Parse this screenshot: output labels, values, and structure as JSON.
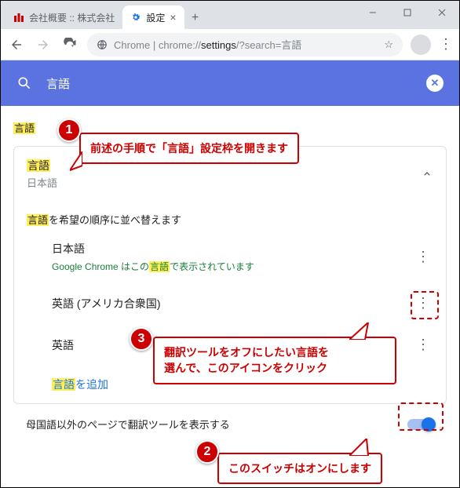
{
  "window": {
    "tabs": [
      {
        "favicon": "atmark",
        "title": "会社概要 :: 株式会社"
      },
      {
        "favicon": "gear",
        "title": "設定"
      }
    ],
    "controls": {
      "minimize": "–",
      "maximize": "□",
      "close": "×"
    }
  },
  "toolbar": {
    "url_prefix": "Chrome",
    "url_sep": " | ",
    "url_main": "chrome://",
    "url_bold": "settings",
    "url_query": "/?search=言語"
  },
  "searchbar": {
    "query": "言語",
    "clear": "✕"
  },
  "section": {
    "title_hl": "言語"
  },
  "card": {
    "head_title_hl": "言語",
    "head_sub": "日本語",
    "instruction_pre_hl": "言語",
    "instruction_rest": "を希望の順序に並べ替えます",
    "langs": [
      {
        "name": "日本語",
        "desc_pre": "Google Chrome はこの",
        "desc_hl": "言語",
        "desc_post": "で表示されています"
      },
      {
        "name": "英語 (アメリカ合衆国)",
        "desc_pre": "",
        "desc_hl": "",
        "desc_post": ""
      },
      {
        "name": "英語",
        "desc_pre": "",
        "desc_hl": "",
        "desc_post": ""
      }
    ],
    "add_pre_hl": "言語",
    "add_rest": "を追加"
  },
  "toggle": {
    "label": "母国語以外のページで翻訳ツールを表示する",
    "on": true
  },
  "annotations": {
    "c1": {
      "num": "1",
      "text": "前述の手順で「言語」設定枠を開きます"
    },
    "c2": {
      "num": "2",
      "text": "このスイッチはオンにします"
    },
    "c3": {
      "num": "3",
      "line1": "翻訳ツールをオフにしたい言語を",
      "line2": "選んで、このアイコンをクリック"
    }
  }
}
